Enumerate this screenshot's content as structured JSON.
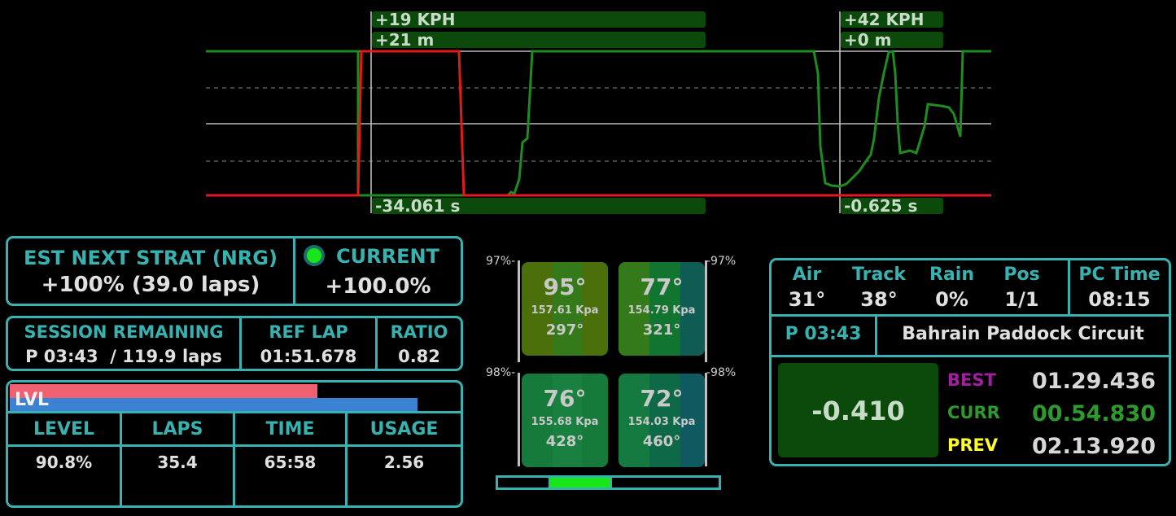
{
  "telemetry": {
    "left": {
      "speed_delta": "+19 KPH",
      "dist_delta": "+21 m",
      "time_delta": "-34.061 s"
    },
    "right": {
      "speed_delta": "+42 KPH",
      "dist_delta": "+0 m",
      "time_delta": "-0.625 s"
    },
    "colors": {
      "throttle": "#1e8c1e",
      "brake": "#e61919"
    }
  },
  "strat": {
    "est_label": "EST NEXT STRAT (NRG)",
    "est_value": "+100% (39.0 laps)",
    "current_label": "CURRENT",
    "current_value": "+100.0%",
    "indicator_color": "#19e619"
  },
  "session": {
    "remaining_label": "SESSION REMAINING",
    "remaining_value": "P 03:43  / 119.9 laps",
    "ref_label": "REF LAP",
    "ref_value": "01:51.678",
    "ratio_label": "RATIO",
    "ratio_value": "0.82"
  },
  "fuel": {
    "bar_label": "LVL",
    "red_fraction": 0.685,
    "blue_fraction": 0.908,
    "headers": [
      "LEVEL",
      "LAPS",
      "TIME",
      "USAGE"
    ],
    "values": [
      "90.8%",
      "35.4",
      "65:58",
      "2.56"
    ]
  },
  "tyres": {
    "front_left_pct": "97%-",
    "front_right_pct": "-97%",
    "rear_left_pct": "98%-",
    "rear_right_pct": "-98%",
    "fl": {
      "temp": "95°",
      "pressure": "157.61 Kpa",
      "brake": "297°"
    },
    "fr": {
      "temp": "77°",
      "pressure": "154.79 Kpa",
      "brake": "321°"
    },
    "rl": {
      "temp": "76°",
      "pressure": "155.68 Kpa",
      "brake": "428°"
    },
    "rr": {
      "temp": "72°",
      "pressure": "154.03 Kpa",
      "brake": "460°"
    }
  },
  "weather": {
    "air_label": "Air",
    "air_value": "31°",
    "track_label": "Track",
    "track_value": "38°",
    "rain_label": "Rain",
    "rain_value": "0%",
    "pos_label": "Pos",
    "pos_value": "1/1",
    "pctime_label": "PC Time",
    "pctime_value": "08:15"
  },
  "track": {
    "session_time": "P 03:43",
    "name": "Bahrain Paddock Circuit"
  },
  "timing": {
    "delta": "-0.410",
    "best_label": "BEST",
    "best_value": "01.29.436",
    "curr_label": "CURR",
    "curr_value": "00.54.830",
    "prev_label": "PREV",
    "prev_value": "02.13.920",
    "best_color": "#a020a0",
    "curr_color": "#2e9a2e",
    "prev_color": "#ffff28"
  }
}
